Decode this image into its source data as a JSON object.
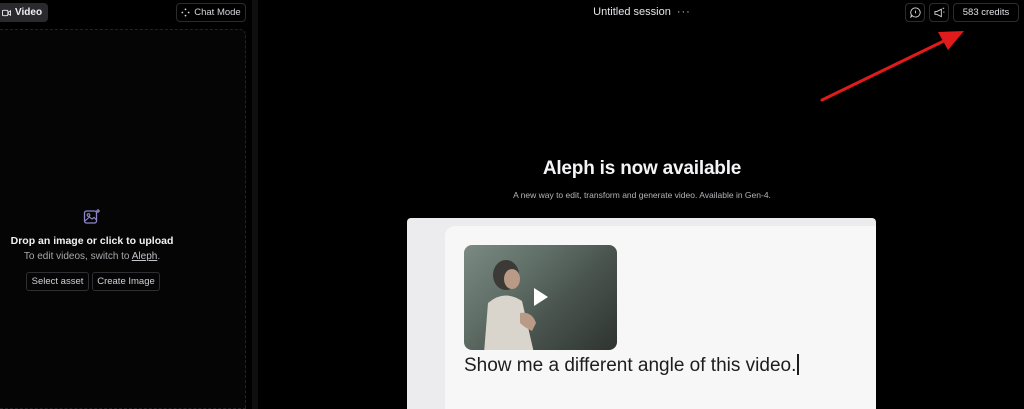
{
  "left_panel": {
    "mode_tab_label": "Video",
    "chat_mode_label": "Chat Mode",
    "drop_title": "Drop an image or click to upload",
    "drop_sub_prefix": "To edit videos, switch to",
    "drop_sub_link": "Aleph",
    "drop_sub_suffix": ".",
    "select_asset_label": "Select asset",
    "create_image_label": "Create Image"
  },
  "header": {
    "session_title": "Untitled session",
    "session_menu": "···",
    "credits_label": "583 credits"
  },
  "announcement": {
    "headline": "Aleph is now available",
    "subline": "A new way to edit, transform and generate video. Available in Gen-4.",
    "prompt_text": "Show me a different angle of this video."
  },
  "colors": {
    "background": "#000000",
    "annotation_arrow": "#e01b1b",
    "card_background": "#f7f7f8"
  }
}
